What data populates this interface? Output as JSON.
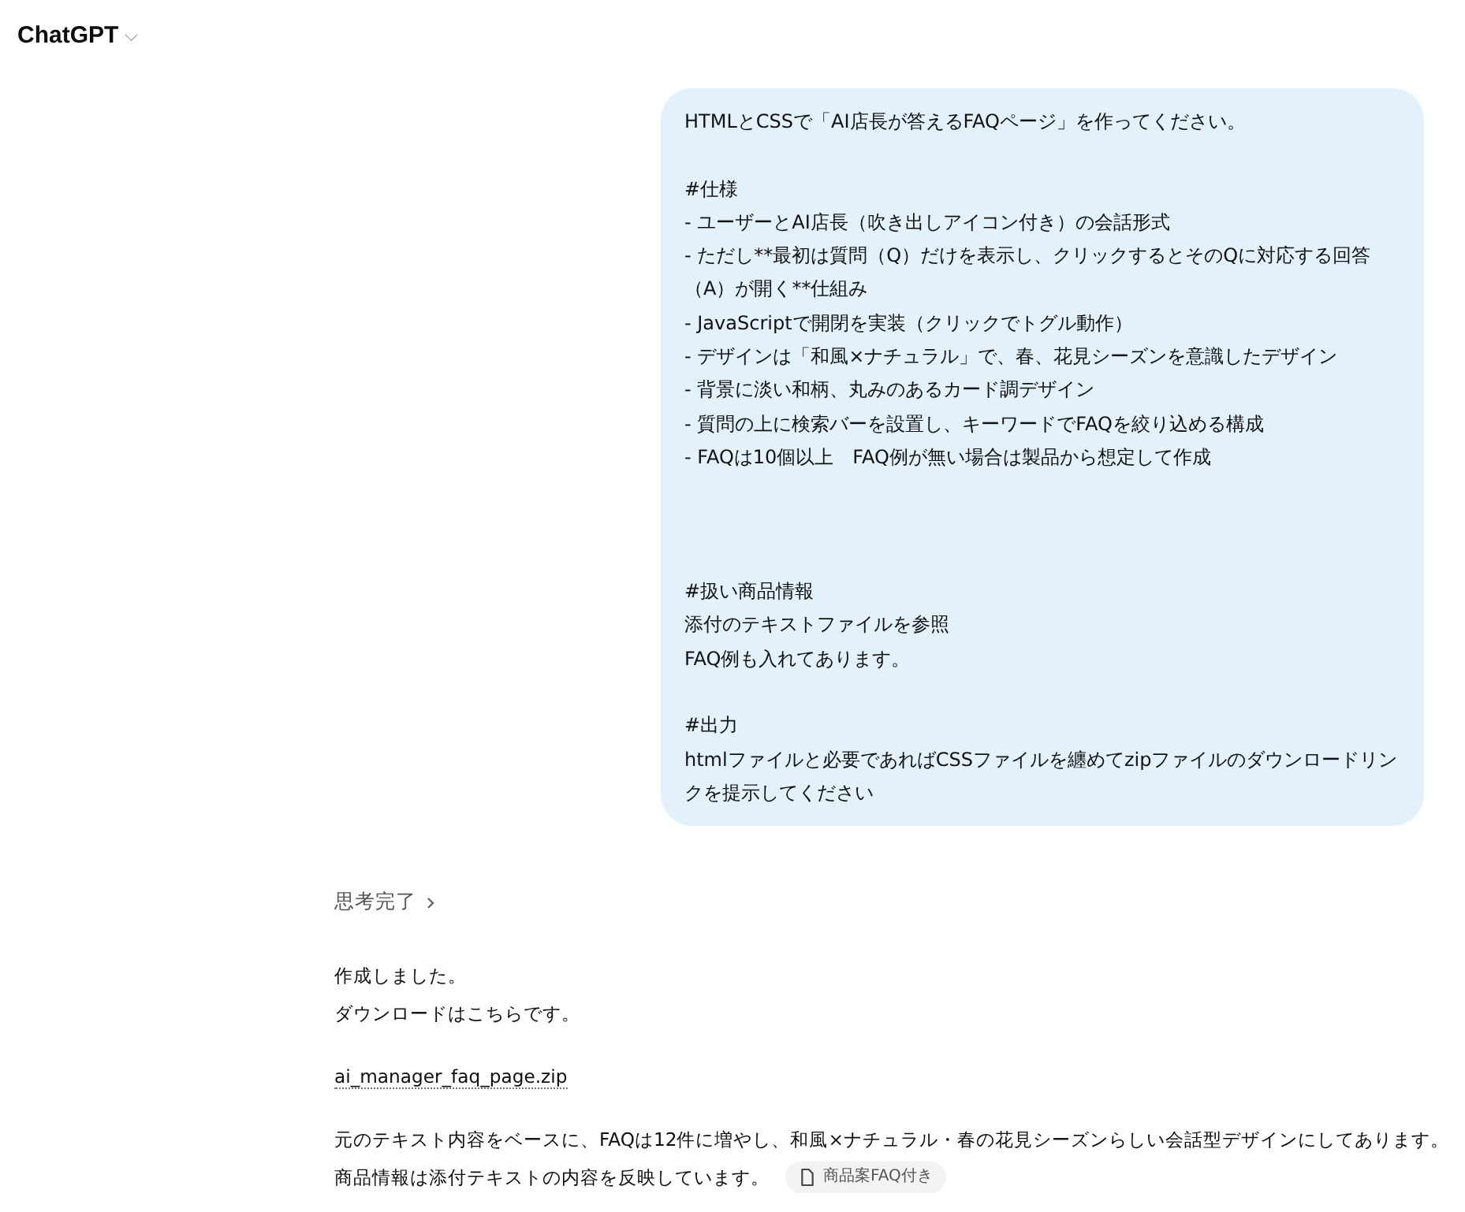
{
  "header": {
    "title": "ChatGPT",
    "dropdown_icon": "⌵"
  },
  "user_message": {
    "blocks": [
      {
        "lines": [
          "HTMLとCSSで「AI店長が答えるFAQページ」を作ってください。"
        ]
      },
      {
        "lines": [
          "#仕様",
          "- ユーザーとAI店長（吹き出しアイコン付き）の会話形式",
          "- ただし**最初は質問（Q）だけを表示し、クリックするとそのQに対応する回答（A）が開く**仕組み",
          "- JavaScriptで開閉を実装（クリックでトグル動作）",
          "- デザインは「和風×ナチュラル」で、春、花見シーズンを意識したデザイン",
          "- 背景に淡い和柄、丸みのあるカード調デザイン",
          "- 質問の上に検索バーを設置し、キーワードでFAQを絞り込める構成",
          "- FAQは10個以上　FAQ例が無い場合は製品から想定して作成"
        ]
      },
      {
        "lines": [
          "#扱い商品情報",
          "添付のテキストファイルを参照",
          "FAQ例も入れてあります。"
        ]
      },
      {
        "lines": [
          "#出力",
          "htmlファイルと必要であればCSSファイルを纏めてzipファイルのダウンロードリンクを提示してください"
        ]
      }
    ]
  },
  "assistant_message": {
    "thinking": {
      "label": "思考完了",
      "expanded": false
    },
    "paragraphs": [
      {
        "kind": "text",
        "lines": [
          "作成しました。",
          "ダウンロードはこちらです。"
        ]
      },
      {
        "kind": "link",
        "text": "ai_manager_faq_page.zip"
      },
      {
        "kind": "text",
        "lines": [
          "元のテキスト内容をベースに、FAQは12件に増やし、和風×ナチュラル・春の花見シーズンらしい会話型デザインにしてあります。",
          "商品情報は添付テキストの内容を反映しています。"
        ],
        "citation": "商品案FAQ付き"
      }
    ]
  }
}
